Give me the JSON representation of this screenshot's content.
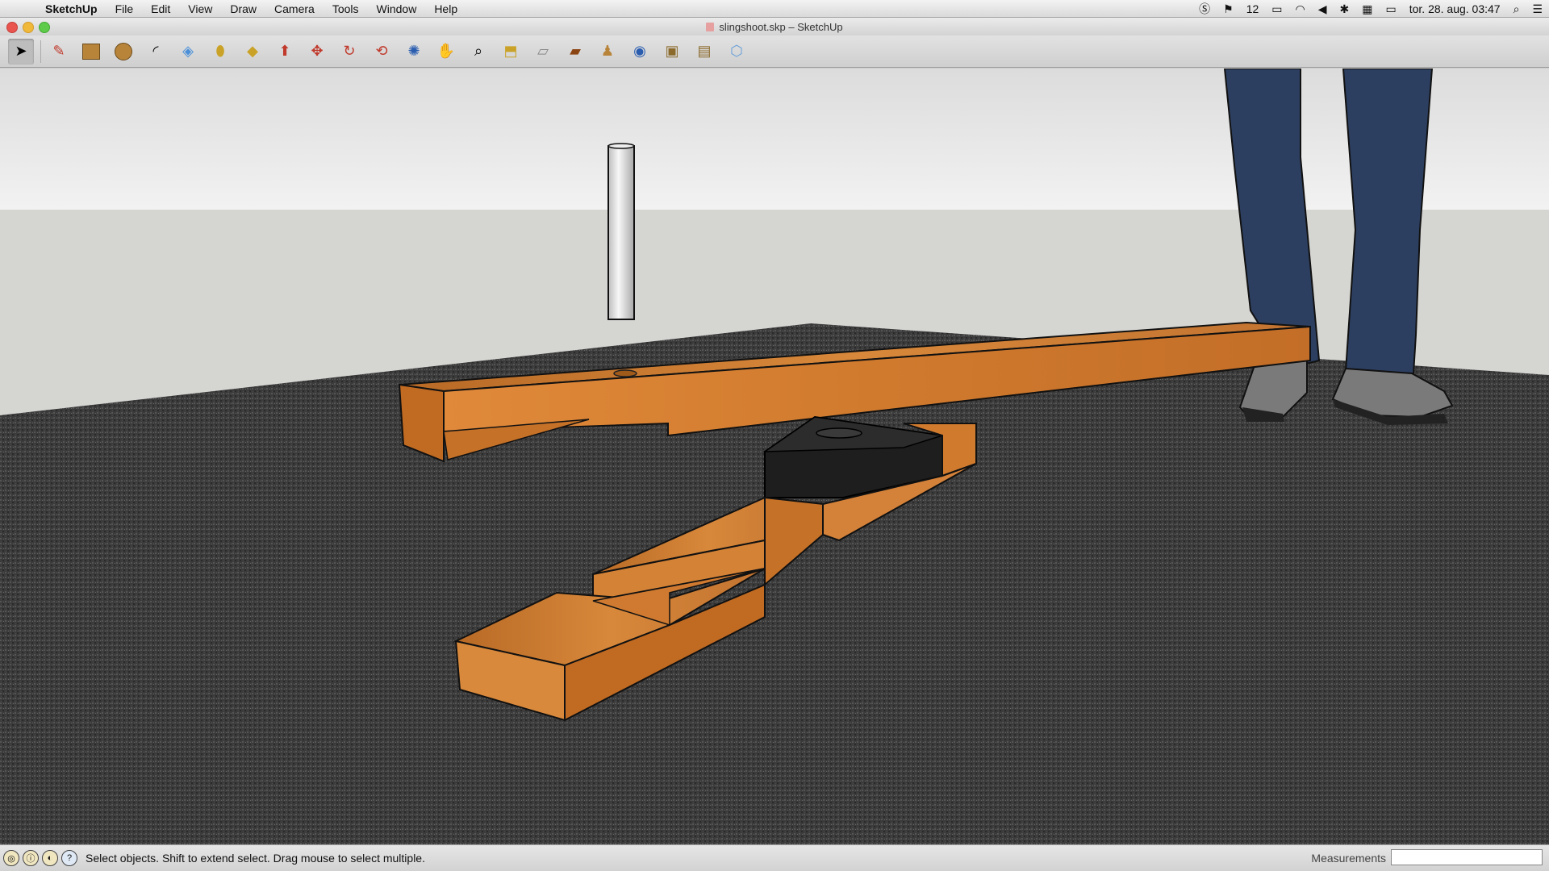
{
  "menubar": {
    "app_name": "SketchUp",
    "items": [
      "File",
      "Edit",
      "View",
      "Draw",
      "Camera",
      "Tools",
      "Window",
      "Help"
    ],
    "status": {
      "notifications": "12",
      "datetime": "tor. 28. aug. 03:47"
    }
  },
  "window": {
    "title": "slingshoot.skp – SketchUp"
  },
  "toolbar": {
    "tools": [
      "select-icon",
      "pencil-icon",
      "rectangle-icon",
      "circle-icon",
      "arc-icon",
      "eraser-icon",
      "tape-measure-icon",
      "paint-bucket-icon",
      "push-pull-icon",
      "move-icon",
      "rotate-icon",
      "offset-icon",
      "orbit-icon",
      "pan-icon",
      "zoom-icon",
      "zoom-extents-icon",
      "previous-view-icon",
      "next-view-icon",
      "position-camera-icon",
      "look-around-icon",
      "walk-icon",
      "section-plane-icon",
      "get-models-icon",
      "share-model-icon"
    ]
  },
  "statusbar": {
    "hint": "Select objects. Shift to extend select. Drag mouse to select multiple.",
    "measurements_label": "Measurements",
    "measurements_value": ""
  },
  "colors": {
    "sky": "#e8e8e8",
    "wall": "#d4d4d4",
    "carpet": "#3a3a3a",
    "wood": "#c9782e",
    "jeans": "#2d3f60"
  }
}
